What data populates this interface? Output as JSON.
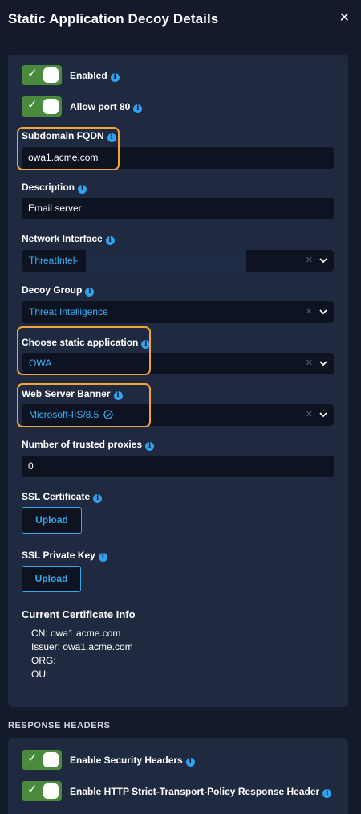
{
  "header": {
    "title": "Static Application Decoy Details",
    "close_glyph": "✕"
  },
  "toggles": {
    "enabled": {
      "label": "Enabled",
      "on": true
    },
    "allow_port_80": {
      "label": "Allow port 80",
      "on": true
    }
  },
  "fields": {
    "subdomain": {
      "label": "Subdomain FQDN",
      "value": "owa1.acme.com"
    },
    "description": {
      "label": "Description",
      "value": "Email server"
    },
    "network_interface": {
      "label": "Network Interface",
      "value": "ThreatIntel-"
    },
    "decoy_group": {
      "label": "Decoy Group",
      "value": "Threat Intelligence"
    },
    "static_application": {
      "label": "Choose static application",
      "value": "OWA"
    },
    "web_server_banner": {
      "label": "Web Server Banner",
      "value": "Microsoft-IIS/8.5"
    },
    "trusted_proxies": {
      "label": "Number of trusted proxies",
      "value": "0"
    },
    "ssl_certificate": {
      "label": "SSL Certificate",
      "button": "Upload"
    },
    "ssl_private_key": {
      "label": "SSL Private Key",
      "button": "Upload"
    }
  },
  "certificate_info": {
    "title": "Current Certificate Info",
    "cn": "CN: owa1.acme.com",
    "issuer": "Issuer: owa1.acme.com",
    "org": "ORG:",
    "ou": "OU:"
  },
  "response_headers": {
    "section_title": "RESPONSE HEADERS",
    "security_headers": {
      "label": "Enable Security Headers",
      "on": true
    },
    "hsts": {
      "label": "Enable HTTP Strict-Transport-Policy Response Header",
      "on": true
    }
  },
  "colors": {
    "background": "#131a2b",
    "panel": "#1f2940",
    "input": "#0e1322",
    "toggle_on": "#4a8a3c",
    "accent": "#3ab0f5",
    "highlight": "#f2a43a"
  },
  "icons": {
    "info": "info-icon",
    "close": "close-icon",
    "check": "check-icon",
    "chevron": "chevron-down-icon",
    "clear": "clear-icon",
    "verified": "verified-check-icon"
  }
}
